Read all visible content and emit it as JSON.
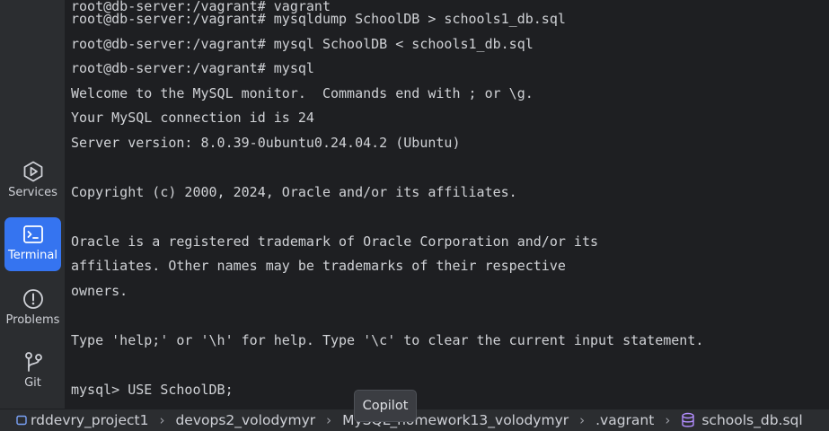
{
  "toolwindows": [
    {
      "label": "Services",
      "icon": "services-icon"
    },
    {
      "label": "Terminal",
      "icon": "terminal-icon",
      "active": true
    },
    {
      "label": "Problems",
      "icon": "problems-icon"
    },
    {
      "label": "Git",
      "icon": "git-icon"
    }
  ],
  "terminal": {
    "lines": [
      "root@db-server:/vagrant# mysqldump SchoolDB > schools1_db.sql",
      "root@db-server:/vagrant# mysql SchoolDB < schools1_db.sql",
      "root@db-server:/vagrant# mysql",
      "Welcome to the MySQL monitor.  Commands end with ; or \\g.",
      "Your MySQL connection id is 24",
      "Server version: 8.0.39-0ubuntu0.24.04.2 (Ubuntu)",
      "",
      "Copyright (c) 2000, 2024, Oracle and/or its affiliates.",
      "",
      "Oracle is a registered trademark of Oracle Corporation and/or its",
      "affiliates. Other names may be trademarks of their respective",
      "owners.",
      "",
      "Type 'help;' or '\\h' for help. Type '\\c' to clear the current input statement.",
      "",
      "mysql> USE SchoolDB;"
    ]
  },
  "breadcrumbs": [
    {
      "label": "rddevry_project1",
      "icon": "project-icon"
    },
    {
      "label": "devops2_volodymyr"
    },
    {
      "label": "MySQL_homework13_volodymyr"
    },
    {
      "label": ".vagrant"
    },
    {
      "label": "schools_db.sql",
      "icon": "database-file-icon"
    }
  ],
  "tooltip": {
    "text": "Copilot"
  },
  "colors": {
    "accent": "#3574f0",
    "background": "#1e1f22",
    "panel": "#2b2d30"
  }
}
